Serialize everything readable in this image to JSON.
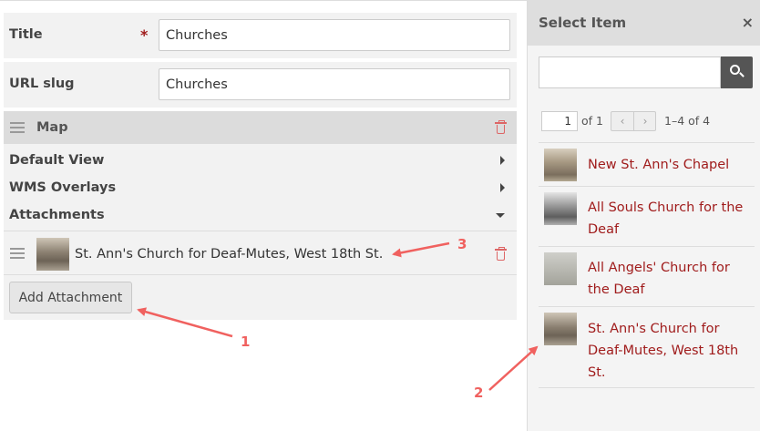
{
  "form": {
    "title_label": "Title",
    "required_marker": "*",
    "title_value": "Churches",
    "slug_label": "URL slug",
    "slug_value": "Churches"
  },
  "map_block": {
    "title": "Map",
    "rows": [
      "Default View",
      "WMS Overlays",
      "Attachments"
    ],
    "attachment_label": "St. Ann's Church for Deaf-Mutes, West 18th St.",
    "add_button_label": "Add Attachment"
  },
  "panel": {
    "title": "Select Item",
    "close_glyph": "×",
    "search_placeholder": "",
    "page_value": "1",
    "page_of": "of 1",
    "prev_glyph": "‹",
    "next_glyph": "›",
    "range_text": "1–4 of 4",
    "items": [
      {
        "label": "New St. Ann's Chapel"
      },
      {
        "label": "All Souls Church for the Deaf"
      },
      {
        "label": "All Angels' Church for the Deaf"
      },
      {
        "label": "St. Ann's Church for Deaf-Mutes, West 18th St."
      }
    ]
  },
  "annotations": [
    "1",
    "2",
    "3"
  ],
  "colors": {
    "accent_red": "#a01c1c",
    "annotation_red": "#f0615f",
    "trash_red": "#dd6666"
  }
}
